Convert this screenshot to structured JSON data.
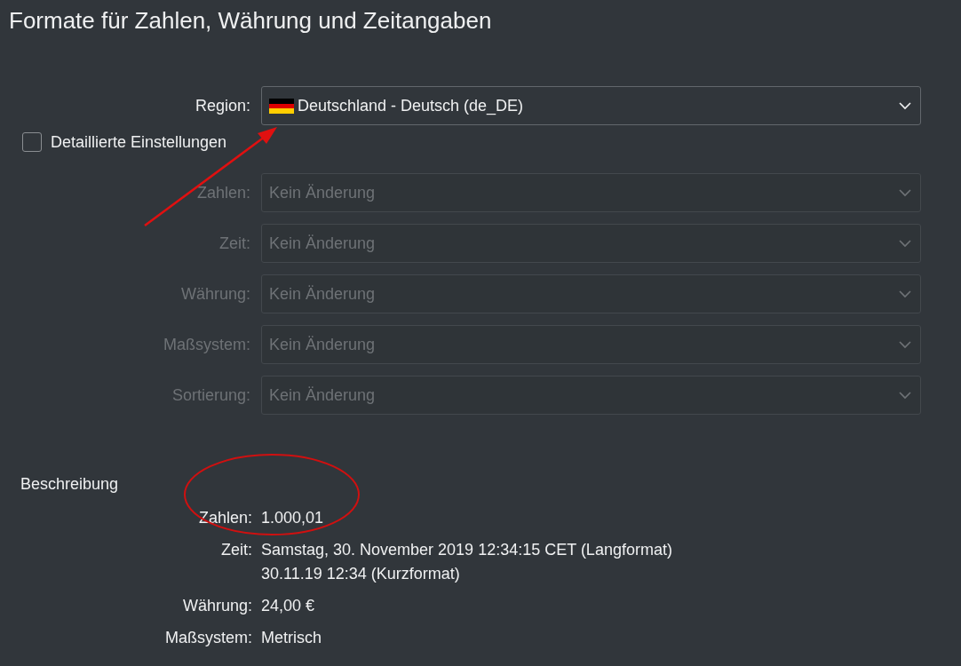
{
  "title": "Formate für Zahlen, Währung und Zeitangaben",
  "region": {
    "label": "Region:",
    "value": "Deutschland - Deutsch (de_DE)",
    "disabled": false
  },
  "detailed_settings": {
    "label": "Detaillierte Einstellungen",
    "checked": false
  },
  "settings": [
    {
      "label": "Zahlen:",
      "value": "Kein Änderung",
      "disabled": true
    },
    {
      "label": "Zeit:",
      "value": "Kein Änderung",
      "disabled": true
    },
    {
      "label": "Währung:",
      "value": "Kein Änderung",
      "disabled": true
    },
    {
      "label": "Maßsystem:",
      "value": "Kein Änderung",
      "disabled": true
    },
    {
      "label": "Sortierung:",
      "value": "Kein Änderung",
      "disabled": true
    }
  ],
  "description": {
    "heading": "Beschreibung",
    "rows": [
      {
        "label": "Zahlen:",
        "lines": [
          "1.000,01"
        ]
      },
      {
        "label": "Zeit:",
        "lines": [
          "Samstag, 30. November 2019 12:34:15 CET (Langformat)",
          "30.11.19 12:34 (Kurzformat)"
        ]
      },
      {
        "label": "Währung:",
        "lines": [
          "24,00 €"
        ]
      },
      {
        "label": "Maßsystem:",
        "lines": [
          "Metrisch"
        ]
      }
    ]
  }
}
